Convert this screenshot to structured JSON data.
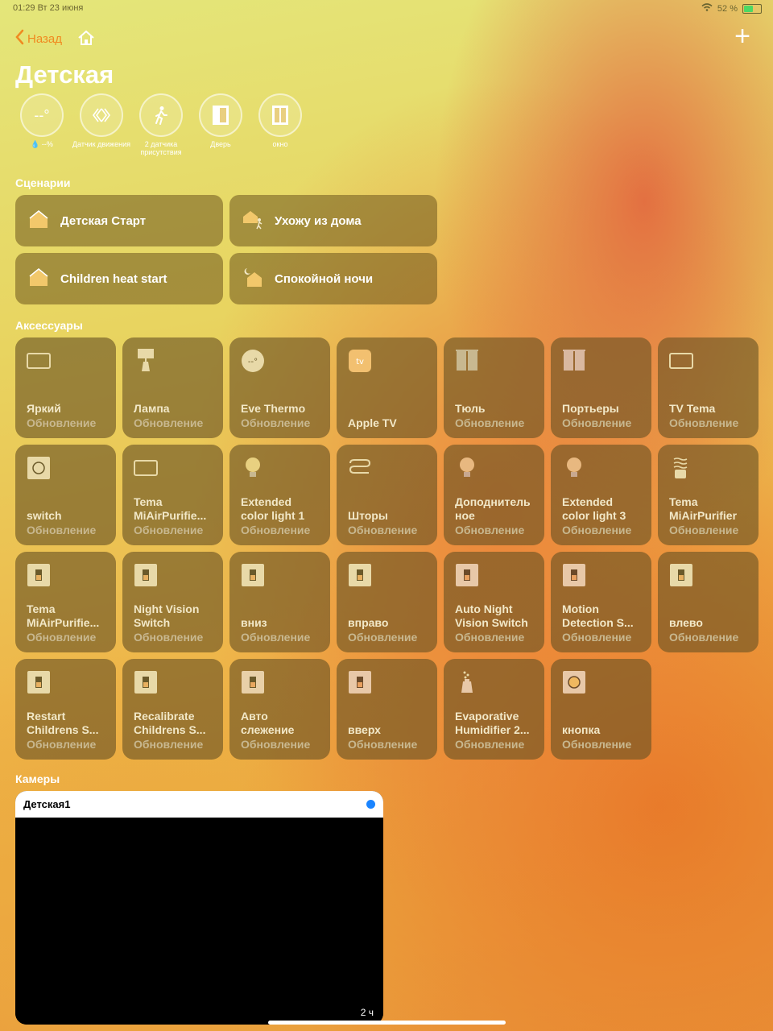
{
  "status": {
    "time_date": "01:29  Вт 23 июня",
    "battery": "52 %"
  },
  "nav": {
    "back_label": "Назад",
    "title": "Детская"
  },
  "indicators": [
    {
      "value": "--°",
      "label": "💧 --%",
      "icon": "thermometer-icon"
    },
    {
      "value": "",
      "label": "Датчик движения",
      "icon": "motion-sensor-icon"
    },
    {
      "value": "",
      "label": "2 датчика присутствия",
      "icon": "person-walking-icon"
    },
    {
      "value": "",
      "label": "Дверь",
      "icon": "door-icon"
    },
    {
      "value": "",
      "label": "окно",
      "icon": "window-icon"
    }
  ],
  "sections": {
    "scenes": "Сценарии",
    "accessories": "Аксессуары",
    "cameras": "Камеры"
  },
  "scenes": [
    {
      "label": "Детская Старт",
      "icon": "house-icon"
    },
    {
      "label": "Ухожу из дома",
      "icon": "house-person-icon"
    },
    {
      "label": "Children heat start",
      "icon": "house-icon"
    },
    {
      "label": "Спокойной ночи",
      "icon": "house-moon-icon"
    }
  ],
  "accessories": [
    {
      "name": "Яркий",
      "status": "Обновление",
      "icon": "display-icon"
    },
    {
      "name": "Лампа",
      "status": "Обновление",
      "icon": "lamp-icon"
    },
    {
      "name": "Eve Thermo",
      "status": "Обновление",
      "icon": "thermostat-icon"
    },
    {
      "name": "Apple TV",
      "status": "",
      "icon": "appletv-icon"
    },
    {
      "name": "Тюль",
      "status": "Обновление",
      "icon": "curtain-icon"
    },
    {
      "name": "Портьеры",
      "status": "Обновление",
      "icon": "curtain-icon"
    },
    {
      "name": "TV Tema",
      "status": "Обновление",
      "icon": "display-icon"
    },
    {
      "name": "switch",
      "status": "Обновление",
      "icon": "button-icon"
    },
    {
      "name": "Tema\nMiAirPurifie...",
      "status": "Обновление",
      "icon": "display-icon"
    },
    {
      "name": "Extended\ncolor light 1",
      "status": "Обновление",
      "icon": "bulb-icon"
    },
    {
      "name": "Шторы",
      "status": "Обновление",
      "icon": "blinds-icon"
    },
    {
      "name": "Доподнитель\nное",
      "status": "Обновление",
      "icon": "bulb-icon"
    },
    {
      "name": "Extended\ncolor light 3",
      "status": "Обновление",
      "icon": "bulb-icon"
    },
    {
      "name": "Tema\nMiAirPurifier",
      "status": "Обновление",
      "icon": "air-purifier-icon"
    },
    {
      "name": "Tema\nMiAirPurifie...",
      "status": "Обновление",
      "icon": "switch-icon"
    },
    {
      "name": "Night Vision\nSwitch",
      "status": "Обновление",
      "icon": "switch-icon"
    },
    {
      "name": "вниз",
      "status": "Обновление",
      "icon": "switch-icon"
    },
    {
      "name": "вправо",
      "status": "Обновление",
      "icon": "switch-icon"
    },
    {
      "name": "Auto Night\nVision Switch",
      "status": "Обновление",
      "icon": "switch-icon"
    },
    {
      "name": "Motion\nDetection S...",
      "status": "Обновление",
      "icon": "switch-icon"
    },
    {
      "name": "влево",
      "status": "Обновление",
      "icon": "switch-icon"
    },
    {
      "name": "Restart\nChildrens S...",
      "status": "Обновление",
      "icon": "switch-icon"
    },
    {
      "name": "Recalibrate\nChildrens S...",
      "status": "Обновление",
      "icon": "switch-icon"
    },
    {
      "name": "Авто\nслежение",
      "status": "Обновление",
      "icon": "switch-icon"
    },
    {
      "name": "вверх",
      "status": "Обновление",
      "icon": "switch-icon"
    },
    {
      "name": "Evaporative\nHumidifier 2...",
      "status": "Обновление",
      "icon": "humidifier-icon"
    },
    {
      "name": "кнопка",
      "status": "Обновление",
      "icon": "button-icon"
    }
  ],
  "camera": {
    "name": "Детская1",
    "time": "2 ч"
  }
}
